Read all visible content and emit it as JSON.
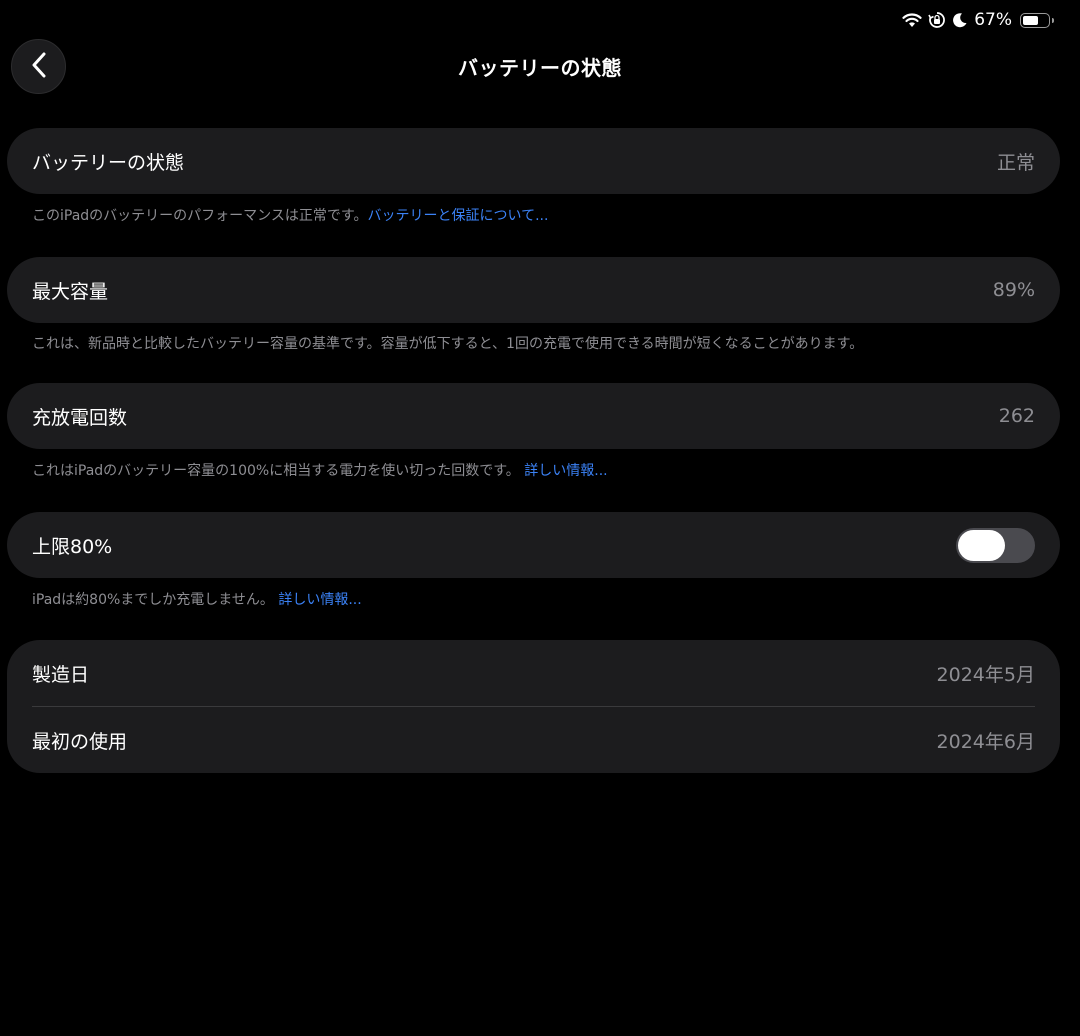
{
  "status_bar": {
    "battery_percent_text": "67%",
    "battery_level": 0.67,
    "icons": [
      "wifi-icon",
      "orientation-lock-icon",
      "moon-icon",
      "battery-icon"
    ]
  },
  "header": {
    "back_icon": "chevron-left-icon",
    "title": "バッテリーの状態"
  },
  "sections": {
    "health": {
      "label": "バッテリーの状態",
      "value": "正常",
      "footnote": "このiPadのバッテリーのパフォーマンスは正常です。",
      "link": "バッテリーと保証について..."
    },
    "capacity": {
      "label": "最大容量",
      "value": "89%",
      "footnote": "これは、新品時と比較したバッテリー容量の基準です。容量が低下すると、1回の充電で使用できる時間が短くなることがあります。"
    },
    "cycles": {
      "label": "充放電回数",
      "value": "262",
      "footnote": "これはiPadのバッテリー容量の100%に相当する電力を使い切った回数です。",
      "link": "詳しい情報..."
    },
    "limit": {
      "label": "上限80%",
      "toggle_on": false,
      "footnote": "iPadは約80%までしか充電しません。",
      "link": "詳しい情報..."
    },
    "dates": {
      "manufactured_label": "製造日",
      "manufactured_value": "2024年5月",
      "first_use_label": "最初の使用",
      "first_use_value": "2024年6月"
    }
  },
  "colors": {
    "background": "#000000",
    "card": "#1c1c1e",
    "secondary_text": "#8e8e93",
    "link": "#3b82f6",
    "toggle_off": "#4a4a4f"
  }
}
